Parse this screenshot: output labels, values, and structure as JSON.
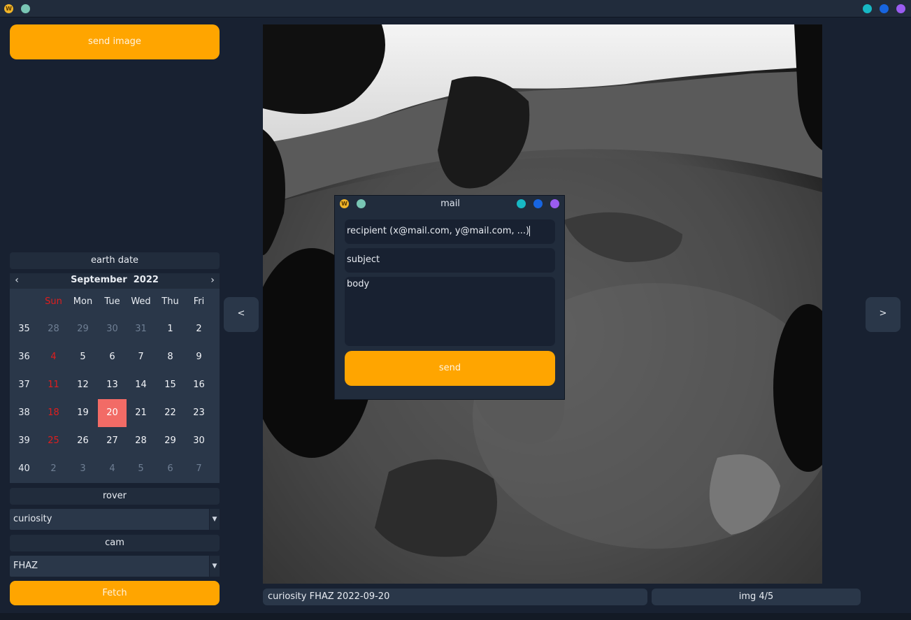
{
  "window": {
    "logo": "W",
    "dots": [
      "#79c6b4"
    ],
    "controls": [
      "#17b8c4",
      "#1765e0",
      "#9a5cf0"
    ]
  },
  "left": {
    "send_image": "send image",
    "earth_date_label": "earth date",
    "rover_label": "rover",
    "rover_value": "curiosity",
    "cam_label": "cam",
    "cam_value": "FHAZ",
    "fetch": "Fetch"
  },
  "calendar": {
    "month": "September",
    "year": "2022",
    "prev": "<",
    "next": ">",
    "weekdays": [
      "Sun",
      "Mon",
      "Tue",
      "Wed",
      "Thu",
      "Fri"
    ],
    "weeks": [
      {
        "num": "35",
        "days": [
          "28",
          "29",
          "30",
          "31",
          "1",
          "2"
        ],
        "dim": [
          true,
          true,
          true,
          true,
          false,
          false
        ]
      },
      {
        "num": "36",
        "days": [
          "4",
          "5",
          "6",
          "7",
          "8",
          "9"
        ],
        "dim": [
          false,
          false,
          false,
          false,
          false,
          false
        ]
      },
      {
        "num": "37",
        "days": [
          "11",
          "12",
          "13",
          "14",
          "15",
          "16"
        ],
        "dim": [
          false,
          false,
          false,
          false,
          false,
          false
        ]
      },
      {
        "num": "38",
        "days": [
          "18",
          "19",
          "20",
          "21",
          "22",
          "23"
        ],
        "dim": [
          false,
          false,
          false,
          false,
          false,
          false
        ]
      },
      {
        "num": "39",
        "days": [
          "25",
          "26",
          "27",
          "28",
          "29",
          "30"
        ],
        "dim": [
          false,
          false,
          false,
          false,
          false,
          false
        ]
      },
      {
        "num": "40",
        "days": [
          "2",
          "3",
          "4",
          "5",
          "6",
          "7"
        ],
        "dim": [
          true,
          true,
          true,
          true,
          true,
          true
        ]
      }
    ],
    "selected": "20"
  },
  "nav": {
    "prev": "<",
    "next": ">"
  },
  "status": {
    "info": "curiosity  FHAZ  2022-09-20",
    "counter": "img 4/5"
  },
  "mail": {
    "title": "mail",
    "recipient": "recipient (x@mail.com, y@mail.com, ...)",
    "subject": "subject",
    "body": "body",
    "send": "send"
  }
}
